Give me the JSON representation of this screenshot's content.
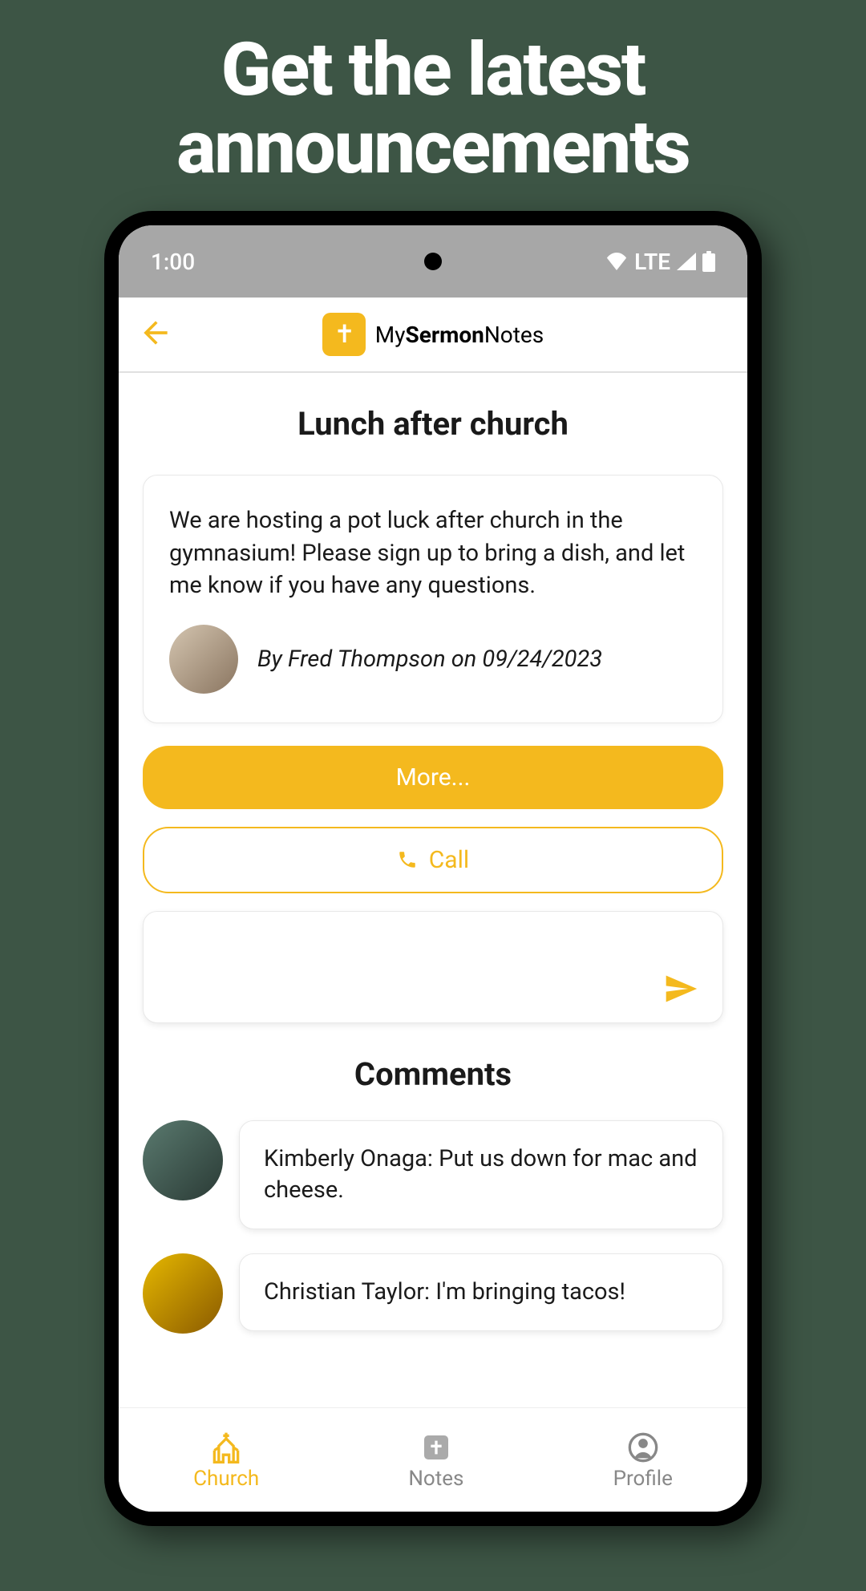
{
  "marketing": {
    "headline": "Get the latest announcements"
  },
  "statusBar": {
    "time": "1:00",
    "network": "LTE"
  },
  "header": {
    "logoPrefix": "My",
    "logoBold": "Sermon",
    "logoSuffix": "Notes"
  },
  "announcement": {
    "title": "Lunch after church",
    "body": "We are hosting a pot luck after church in the gymnasium! Please sign up to bring a dish, and let me know if you have any questions.",
    "byline": "By Fred Thompson on 09/24/2023"
  },
  "buttons": {
    "more": "More...",
    "call": "Call"
  },
  "commentsSection": {
    "title": "Comments"
  },
  "comments": [
    {
      "text": "Kimberly Onaga: Put us down for mac and cheese."
    },
    {
      "text": "Christian Taylor: I'm bringing tacos!"
    }
  ],
  "nav": {
    "church": "Church",
    "notes": "Notes",
    "profile": "Profile"
  }
}
